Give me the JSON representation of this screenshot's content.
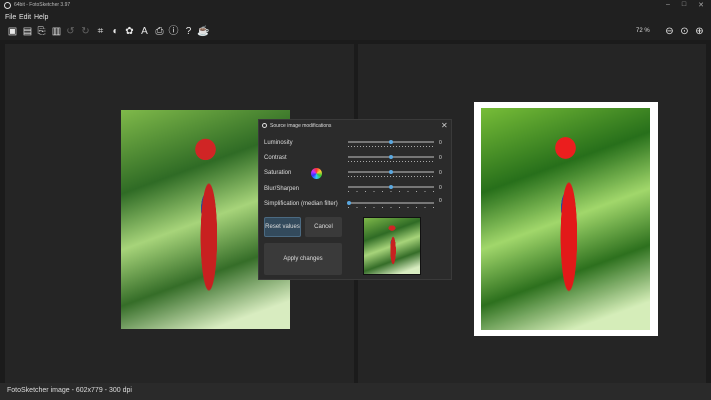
{
  "window": {
    "title": "64bit - FotoSketcher 3.97",
    "minimize": "–",
    "maximize": "□",
    "close": "✕"
  },
  "menu": [
    "File",
    "Edit",
    "Help"
  ],
  "toolbar": {
    "zoom_level": "72 %"
  },
  "dialog": {
    "title": "Source image modifications",
    "close": "✕",
    "sliders": [
      {
        "label": "Luminosity",
        "value": "0",
        "position": 0.5
      },
      {
        "label": "Contrast",
        "value": "0",
        "position": 0.5
      },
      {
        "label": "Saturation",
        "value": "0",
        "position": 0.5
      },
      {
        "label": "Blur/Sharpen",
        "value": "0",
        "position": 0.5
      },
      {
        "label": "Simplification (median filter)",
        "value": "0",
        "position": 0
      }
    ],
    "reset": "Reset values",
    "cancel": "Cancel",
    "apply": "Apply changes"
  },
  "status": "FotoSketcher image - 602x779 - 300 dpi"
}
